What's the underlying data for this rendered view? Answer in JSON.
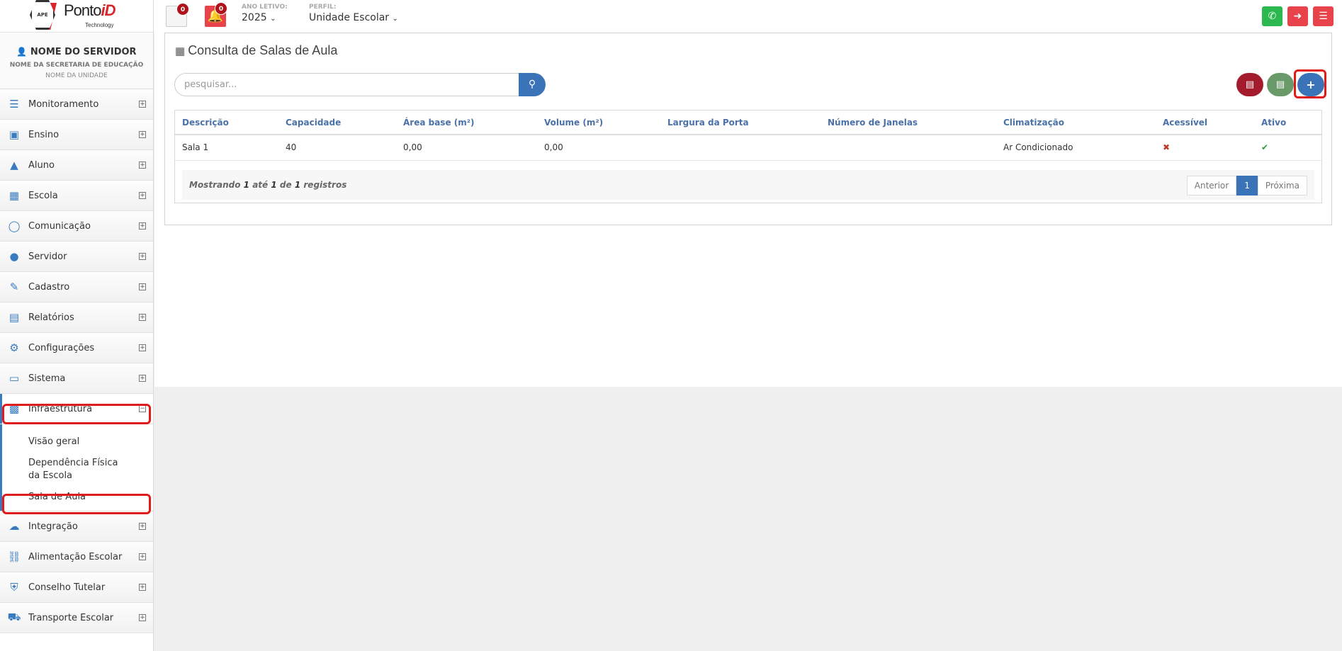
{
  "brand": {
    "logo_main": "Ponto",
    "logo_accent": "iD",
    "logo_sub": "Technology",
    "logo_badge": "APE"
  },
  "topbar": {
    "messages_count": "0",
    "notifications_count": "0",
    "ano_letivo_label": "ANO LETIVO:",
    "ano_letivo_value": "2025",
    "perfil_label": "PERFIL:",
    "perfil_value": "Unidade Escolar",
    "colors": {
      "whatsapp": "#2bb84f",
      "logout": "#e8434a",
      "menu": "#e8434a",
      "bell": "#e8434a"
    }
  },
  "profile": {
    "name": "NOME DO SERVIDOR",
    "secretaria": "NOME DA SECRETARIA DE EDUCAÇÃO",
    "unidade": "NOME DA UNIDADE"
  },
  "sidebar": {
    "items": [
      {
        "label": "Monitoramento",
        "icon": "sliders-icon"
      },
      {
        "label": "Ensino",
        "icon": "book-icon"
      },
      {
        "label": "Aluno",
        "icon": "graduation-cap-icon"
      },
      {
        "label": "Escola",
        "icon": "institution-icon"
      },
      {
        "label": "Comunicação",
        "icon": "chat-bubble-icon"
      },
      {
        "label": "Servidor",
        "icon": "user-icon"
      },
      {
        "label": "Cadastro",
        "icon": "edit-icon"
      },
      {
        "label": "Relatórios",
        "icon": "document-icon"
      },
      {
        "label": "Configurações",
        "icon": "gear-icon"
      },
      {
        "label": "Sistema",
        "icon": "monitor-icon"
      },
      {
        "label": "Infraestrutura",
        "icon": "building-icon"
      }
    ],
    "submenu": [
      "Visão geral",
      "Dependência Física da Escola",
      "Sala de Aula"
    ],
    "items_after": [
      {
        "label": "Integração",
        "icon": "cloud-icon"
      },
      {
        "label": "Alimentação Escolar",
        "icon": "cutlery-icon"
      },
      {
        "label": "Conselho Tutelar",
        "icon": "shield-icon"
      },
      {
        "label": "Transporte Escolar",
        "icon": "car-icon"
      }
    ]
  },
  "main": {
    "title": "Consulta de Salas de Aula",
    "search_placeholder": "pesquisar...",
    "buttons": {
      "pdf_color": "#a31b2c",
      "excel_color": "#6a9a6a",
      "add_color": "#3a73b8",
      "add_label": "+"
    },
    "table": {
      "columns": [
        "Descrição",
        "Capacidade",
        "Área base (m²)",
        "Volume (m²)",
        "Largura da Porta",
        "Número de Janelas",
        "Climatização",
        "Acessível",
        "Ativo"
      ],
      "rows": [
        {
          "descricao": "Sala 1",
          "capacidade": "40",
          "area": "0,00",
          "volume": "0,00",
          "largura": "",
          "janelas": "",
          "climatizacao": "Ar Condicionado",
          "acessivel": "✖",
          "ativo": "✔"
        }
      ]
    },
    "footer": {
      "mostrando": "Mostrando",
      "from": "1",
      "ate": "até",
      "to": "1",
      "de": "de",
      "total": "1",
      "registros": "registros"
    },
    "pagination": {
      "prev": "Anterior",
      "current": "1",
      "next": "Próxima"
    }
  }
}
